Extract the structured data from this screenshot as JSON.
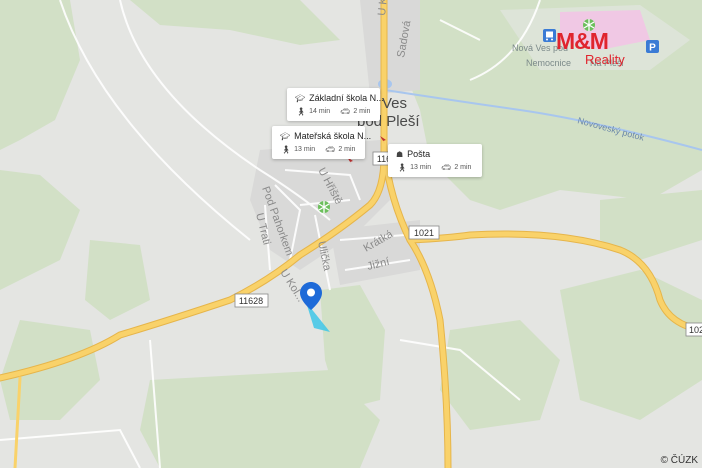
{
  "town": {
    "line1": "Ves",
    "line2": "pod Pleší"
  },
  "streets": [
    "Sadová",
    "U Hřiště",
    "Pod Pahorkem",
    "U Trati",
    "Ulička",
    "Krátká",
    "Jižní",
    "U Kol...",
    "U Kř..."
  ],
  "road_numbers": [
    "1021",
    "11628",
    "116",
    "102"
  ],
  "places": {
    "upper_village": "Nová Ves pod",
    "hospital": "Nemocnice",
    "na_plesi": "Na Pleši",
    "creek": "Novoveský potok"
  },
  "poi_cards": [
    {
      "name": "Základní škola N...",
      "icon": "school-icon",
      "walk": "14 min",
      "car": "2 min"
    },
    {
      "name": "Mateřská škola N...",
      "icon": "school-icon",
      "walk": "13 min",
      "car": "2 min"
    },
    {
      "name": "Pošta",
      "icon": "post-office-icon",
      "walk": "13 min",
      "car": "2 min"
    }
  ],
  "logo": {
    "brand": "M&M",
    "sub": "Reality"
  },
  "attribution": "© ČÚZK",
  "colors": {
    "road": "#f7c95b",
    "road_edge": "#e8b84a",
    "forest": "#d3e2c8",
    "land": "#e6e6e4",
    "built_up": "#dcdcdc",
    "pin": "#1e6ad8",
    "brand": "#e0242e"
  }
}
